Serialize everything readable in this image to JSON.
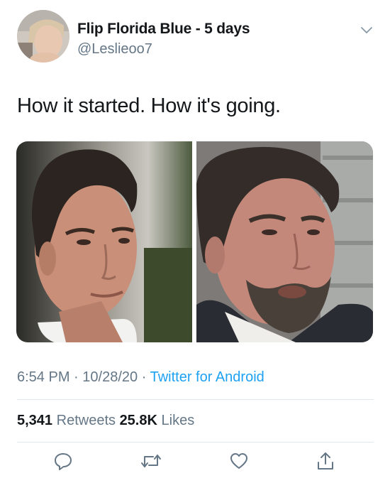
{
  "tweet": {
    "author": "Flip Florida Blue - 5 days",
    "handle": "@Leslieoo7",
    "text": "How it started. How it's going.",
    "time": "6:54 PM",
    "date": "10/28/20",
    "source": "Twitter for Android",
    "sep": "·",
    "retweets_count": "5,341",
    "retweets_label": "Retweets",
    "likes_count": "25.8K",
    "likes_label": "Likes"
  },
  "icons": {
    "menu": "chevron-down-icon",
    "reply": "reply-icon",
    "retweet": "retweet-icon",
    "like": "heart-icon",
    "share": "share-icon"
  },
  "colors": {
    "secondary_text": "#657786",
    "link": "#1da1f2",
    "divider": "#e1e8ed"
  }
}
